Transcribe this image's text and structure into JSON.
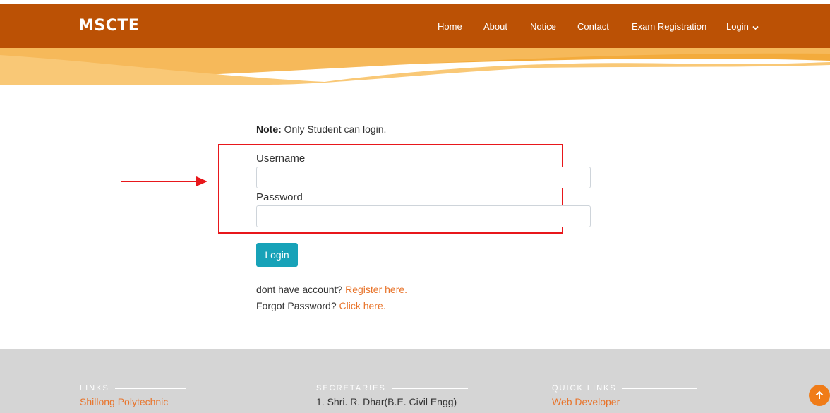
{
  "header": {
    "brand": "MSCTE",
    "nav": [
      {
        "label": "Home"
      },
      {
        "label": "About"
      },
      {
        "label": "Notice"
      },
      {
        "label": "Contact"
      },
      {
        "label": "Exam Registration"
      },
      {
        "label": "Login"
      }
    ],
    "colors": {
      "bar": "#bb5105",
      "wave_light": "#f9c876",
      "wave_dark": "#f3ab3c"
    }
  },
  "form": {
    "note_bold": "Note:",
    "note_text": " Only Student can login.",
    "username_label": "Username",
    "username_value": "",
    "password_label": "Password",
    "password_value": "",
    "login_button": "Login",
    "register_prompt": "dont have account? ",
    "register_link": "Register here.",
    "forgot_prompt": "Forgot Password? ",
    "forgot_link": "Click here.",
    "button_color": "#17a2b8",
    "highlight_color": "#e8171b"
  },
  "footer": {
    "links": {
      "heading": "LINKS",
      "items": [
        "Shillong Polytechnic"
      ]
    },
    "secretaries": {
      "heading": "SECRETARIES",
      "items": [
        "1. Shri. R. Dhar(B.E. Civil Engg)"
      ]
    },
    "quick_links": {
      "heading": "QUICK LINKS",
      "items": [
        "Web Developer"
      ]
    },
    "back_to_top_icon": "arrow-up-icon"
  }
}
